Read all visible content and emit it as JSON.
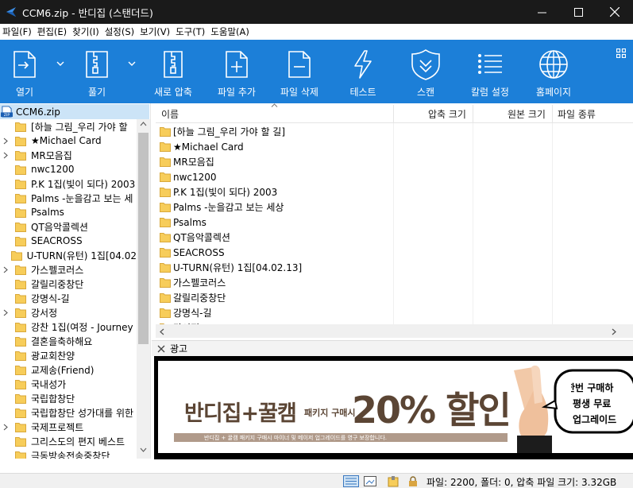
{
  "window": {
    "title": "CCM6.zip - 반디집 (스탠더드)"
  },
  "menu": [
    "파일(F)",
    "편집(E)",
    "찾기(I)",
    "설정(S)",
    "보기(V)",
    "도구(T)",
    "도움말(A)"
  ],
  "toolbar": {
    "buttons": [
      {
        "label": "열기",
        "icon": "open-icon"
      },
      {
        "label": "풀기",
        "icon": "extract-icon"
      },
      {
        "label": "새로 압축",
        "icon": "new-archive-icon"
      },
      {
        "label": "파일 추가",
        "icon": "add-file-icon"
      },
      {
        "label": "파일 삭제",
        "icon": "delete-file-icon"
      },
      {
        "label": "테스트",
        "icon": "test-icon"
      },
      {
        "label": "스캔",
        "icon": "scan-icon"
      },
      {
        "label": "칼럼 설정",
        "icon": "column-settings-icon"
      },
      {
        "label": "홈페이지",
        "icon": "homepage-icon"
      }
    ]
  },
  "tree": {
    "root": "CCM6.zip",
    "items": [
      {
        "label": "[하늘 그림_우리 가야 할",
        "expandable": false
      },
      {
        "label": "★Michael Card",
        "expandable": true
      },
      {
        "label": "MR모음집",
        "expandable": true
      },
      {
        "label": "nwc1200",
        "expandable": false
      },
      {
        "label": "P.K 1집(빛이 되다) 2003",
        "expandable": false
      },
      {
        "label": "Palms -눈을감고 보는 세",
        "expandable": false
      },
      {
        "label": "Psalms",
        "expandable": false
      },
      {
        "label": "QT음악콜렉션",
        "expandable": false
      },
      {
        "label": "SEACROSS",
        "expandable": false
      },
      {
        "label": "U-TURN(유턴) 1집[04.02",
        "expandable": false
      },
      {
        "label": "가스펠코러스",
        "expandable": true
      },
      {
        "label": "갈릴리중창단",
        "expandable": false
      },
      {
        "label": "강명식-길",
        "expandable": false
      },
      {
        "label": "강서정",
        "expandable": true
      },
      {
        "label": "강찬 1집(여정 - Journey",
        "expandable": false
      },
      {
        "label": "결혼을축하해요",
        "expandable": false
      },
      {
        "label": "광교회찬양",
        "expandable": false
      },
      {
        "label": "교제송(Friend)",
        "expandable": false
      },
      {
        "label": "국내성가",
        "expandable": false
      },
      {
        "label": "국립합창단",
        "expandable": false
      },
      {
        "label": "국립합창단 성가대를 위한",
        "expandable": false
      },
      {
        "label": "국제프로젝트",
        "expandable": true
      },
      {
        "label": "그리스도의 편지 베스트",
        "expandable": false
      },
      {
        "label": "극동방송전송중창단",
        "expandable": false
      }
    ]
  },
  "list": {
    "columns": [
      "이름",
      "압축 크기",
      "원본 크기",
      "파일 종류"
    ],
    "rows": [
      "[하늘 그림_우리 가야 할 길]",
      "★Michael Card",
      "MR모음집",
      "nwc1200",
      "P.K 1집(빛이 되다) 2003",
      "Palms -눈을감고 보는 세상",
      "Psalms",
      "QT음악콜렉션",
      "SEACROSS",
      "U-TURN(유턴) 1집[04.02.13]",
      "가스펠코러스",
      "갈릴리중창단",
      "강명식-길",
      "강서정"
    ]
  },
  "ad": {
    "title": "광고",
    "headline": "반디집+꿀캠",
    "package": "패키지 구매시",
    "discount": "20% 할인",
    "note": "반디집 + 꿀캠 패키지 구매시 마이너 및 메이저 업그레이드를 영구 보장합니다.",
    "side_lines": [
      "한번 구매하",
      "평생 무료",
      "업그레이드"
    ]
  },
  "status": {
    "text": "파일: 2200, 폴더: 0, 압축 파일 크기: 3.32GB"
  },
  "colors": {
    "toolbar": "#1c7fd8",
    "titlebar": "#1a1a1a",
    "folder": "#f7cd5a",
    "selection": "#cce4f7"
  }
}
